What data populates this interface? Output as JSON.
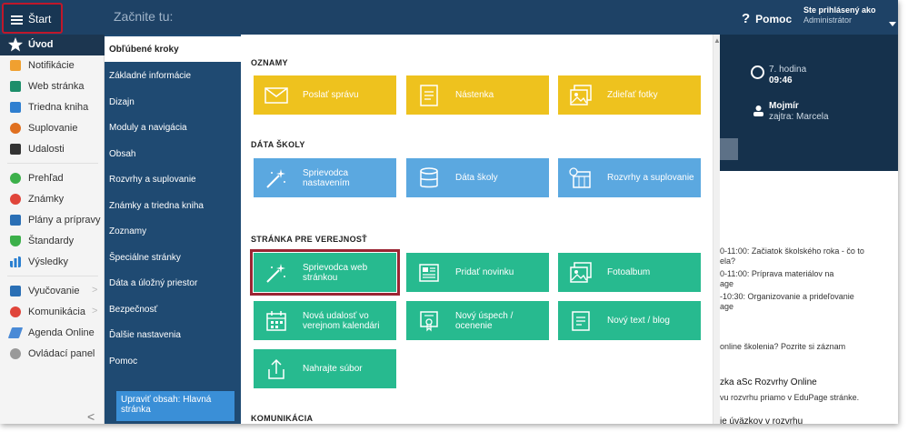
{
  "topbar": {
    "start_label": "Štart",
    "search_prompt": "Začnite tu:",
    "help_label": "Pomoc",
    "user_title": "Ste prihlásený ako",
    "user_role": "Administrátor"
  },
  "sidebar": {
    "items": [
      {
        "label": "Úvod",
        "icon": "star-icon"
      },
      {
        "label": "Notifikácie",
        "icon": "mail-icon"
      },
      {
        "label": "Web stránka",
        "icon": "home-icon"
      },
      {
        "label": "Triedna kniha",
        "icon": "book-icon"
      },
      {
        "label": "Suplovanie",
        "icon": "substitution-icon"
      },
      {
        "label": "Udalosti",
        "icon": "calendar-icon"
      },
      {
        "label": "Prehľad",
        "icon": "check-icon"
      },
      {
        "label": "Známky",
        "icon": "grades-icon"
      },
      {
        "label": "Plány a prípravy",
        "icon": "plans-icon"
      },
      {
        "label": "Štandardy",
        "icon": "shield-icon"
      },
      {
        "label": "Výsledky",
        "icon": "bar-chart-icon"
      },
      {
        "label": "Vyučovanie",
        "icon": "briefcase-icon"
      },
      {
        "label": "Komunikácia",
        "icon": "people-icon"
      },
      {
        "label": "Agenda Online",
        "icon": "pen-icon"
      },
      {
        "label": "Ovládací panel",
        "icon": "gear-icon"
      }
    ]
  },
  "categories": {
    "items": [
      "Obľúbené kroky",
      "Základné informácie",
      "Dizajn",
      "Moduly a navigácia",
      "Obsah",
      "Rozvrhy a suplovanie",
      "Známky a triedna kniha",
      "Zoznamy",
      "Špeciálne stránky",
      "Dáta a úložný priestor",
      "Bezpečnosť",
      "Ďalšie nastavenia",
      "Pomoc"
    ],
    "edit_button": "Upraviť obsah: Hlavná stránka"
  },
  "panel": {
    "sections": {
      "announcements": "OZNAMY",
      "school_data": "DÁTA ŠKOLY",
      "public_page": "STRÁNKA PRE VEREJNOSŤ",
      "communication": "KOMUNIKÁCIA"
    },
    "tiles": {
      "send_message": "Poslať správu",
      "board": "Nástenka",
      "share_photos": "Zdieľať fotky",
      "setup_wizard": "Sprievodca nastavením",
      "school_data": "Dáta školy",
      "timetables": "Rozvrhy a suplovanie",
      "web_wizard": "Sprievodca web stránkou",
      "add_news": "Pridať novinku",
      "photo_album": "Fotoalbum",
      "new_event": "Nová udalosť vo verejnom kalendári",
      "new_success": "Nový úspech / ocenenie",
      "new_text": "Nový text / blog",
      "upload_file": "Nahrajte súbor"
    },
    "tile_colors": {
      "yellow": "#eec21e",
      "blue": "#5ba8e0",
      "green": "#27ba8f"
    }
  },
  "right": {
    "hour_label": "7. hodina",
    "hour_time": "09:46",
    "duty_name": "Mojmír",
    "duty_next": "zajtra: Marcela",
    "lines": [
      "0-11:00: Začiatok školského roka - čo to",
      "ela?",
      "0-11:00: Príprava materiálov na",
      "age",
      "-10:30: Organizovanie a prideľovanie",
      "age",
      "online školenia? Pozrite si záznam",
      "zka aSc Rozvrhy Online",
      "vu rozvrhu priamo v EduPage stránke.",
      "ie úväzkov v rozvrhu"
    ]
  },
  "colors": {
    "topbar": "#1e4266",
    "catmenu": "#1f4a72",
    "highlight": "#9b2533"
  }
}
